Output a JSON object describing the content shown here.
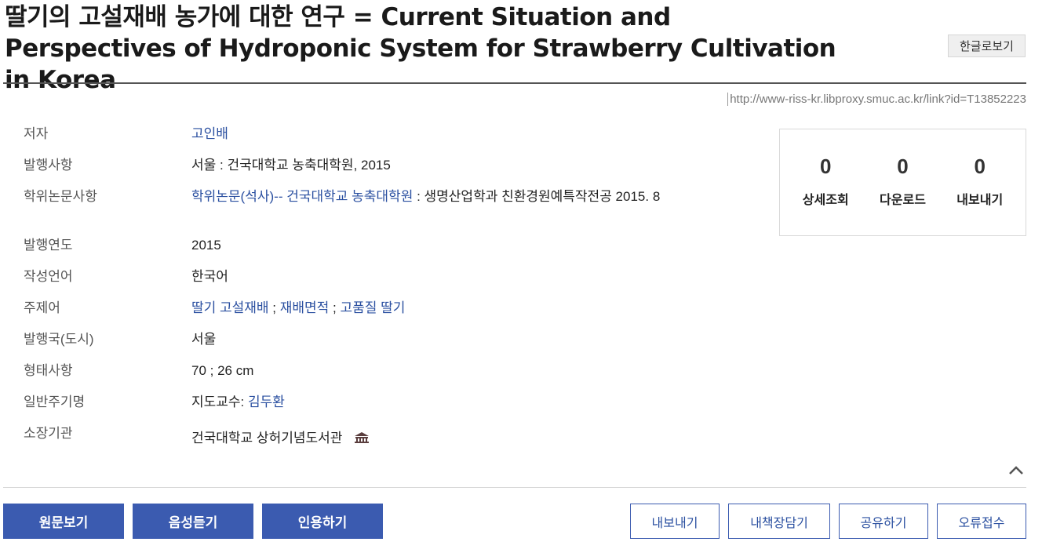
{
  "title": "딸기의 고설재배 농가에 대한 연구 = Current Situation and Perspectives of Hydroponic System for Strawberry Cultivation in Korea",
  "lang_toggle": "한글로보기",
  "url": "http://www-riss-kr.libproxy.smuc.ac.kr/link?id=T13852223",
  "meta": {
    "author_label": "저자",
    "author": "고인배",
    "publication_label": "발행사항",
    "publication": "서울 : 건국대학교 농축대학원, 2015",
    "thesis_label": "학위논문사항",
    "thesis_link": "학위논문(석사)-- 건국대학교 농축대학원",
    "thesis_rest": " : 생명산업학과 친환경원예특작전공 2015. 8",
    "year_label": "발행연도",
    "year": "2015",
    "language_label": "작성언어",
    "language": "한국어",
    "subject_label": "주제어",
    "subjects": [
      "딸기 고설재배",
      "재배면적",
      "고품질 딸기"
    ],
    "subject_sep": " ; ",
    "country_label": "발행국(도시)",
    "country": "서울",
    "format_label": "형태사항",
    "format": "70 ; 26 cm",
    "note_label": "일반주기명",
    "note_prefix": "지도교수: ",
    "advisor": "김두환",
    "holding_label": "소장기관",
    "holding": "건국대학교 상허기념도서관"
  },
  "stats": [
    {
      "value": "0",
      "label": "상세조회"
    },
    {
      "value": "0",
      "label": "다운로드"
    },
    {
      "value": "0",
      "label": "내보내기"
    }
  ],
  "actions": {
    "view_original": "원문보기",
    "listen": "음성듣기",
    "cite": "인용하기",
    "export": "내보내기",
    "bookshelf": "내책장담기",
    "share": "공유하기",
    "report_error": "오류접수"
  },
  "colors": {
    "accent": "#3b5bb0",
    "link": "#2a4fa0"
  }
}
